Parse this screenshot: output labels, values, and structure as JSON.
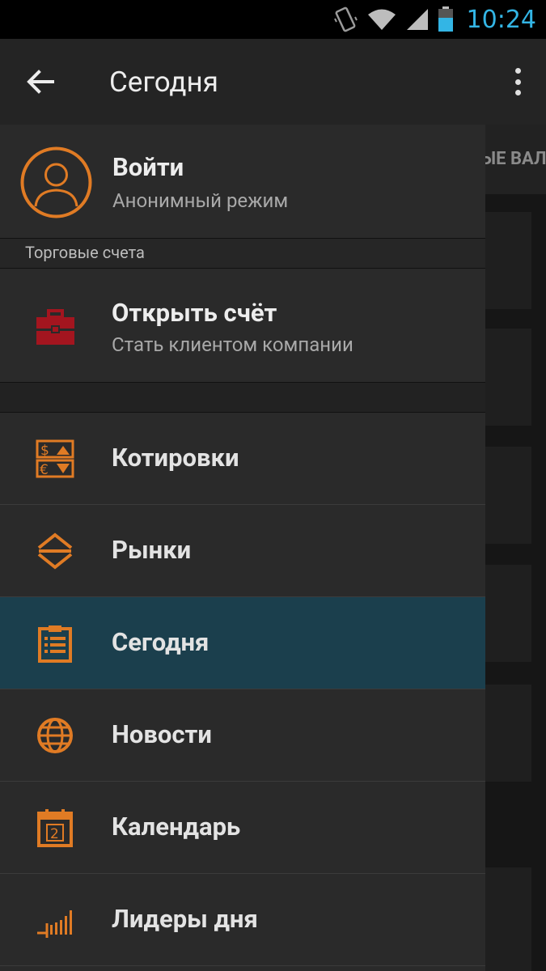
{
  "status_bar": {
    "time": "10:24"
  },
  "action_bar": {
    "title": "Сегодня"
  },
  "background": {
    "tab_label": "ЫЕ ВАЛ"
  },
  "profile": {
    "login_label": "Войти",
    "mode": "Анонимный режим"
  },
  "trading_accounts": {
    "section_title": "Торговые счета",
    "open_account_label": "Открыть счёт",
    "open_account_sub": "Стать клиентом компании"
  },
  "menu": {
    "items": [
      {
        "label": "Котировки",
        "icon": "quotes-icon",
        "active": false
      },
      {
        "label": "Рынки",
        "icon": "markets-icon",
        "active": false
      },
      {
        "label": "Сегодня",
        "icon": "clipboard-icon",
        "active": true
      },
      {
        "label": "Новости",
        "icon": "globe-icon",
        "active": false
      },
      {
        "label": "Календарь",
        "icon": "calendar-icon",
        "active": false
      },
      {
        "label": "Лидеры дня",
        "icon": "bars-chart-icon",
        "active": false
      }
    ]
  },
  "colors": {
    "accent_orange": "#e07b24",
    "briefcase_red": "#a3151f",
    "active_item": "#1b3f4d",
    "status_time": "#33b5e5"
  }
}
